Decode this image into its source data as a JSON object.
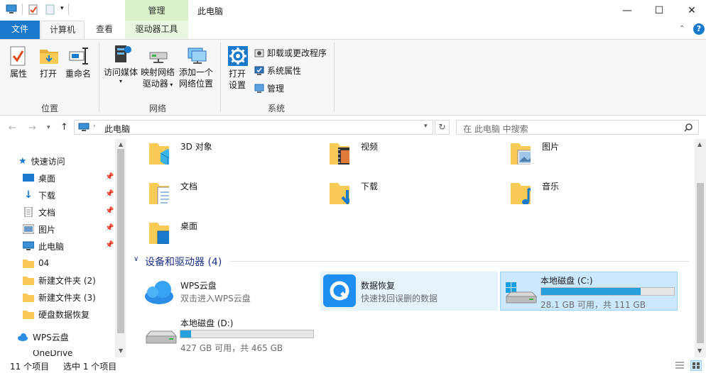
{
  "window": {
    "title": "此电脑",
    "context_tab": "管理"
  },
  "tabs": {
    "file": "文件",
    "computer": "计算机",
    "view": "查看",
    "drive_tools": "驱动器工具"
  },
  "ribbon": {
    "location": {
      "properties": "属性",
      "open": "打开",
      "rename": "重命名",
      "group": "位置"
    },
    "network": {
      "access_media": "访问媒体",
      "map_drive_1": "映射网络",
      "map_drive_2": "驱动器",
      "add_location_1": "添加一个",
      "add_location_2": "网络位置",
      "group": "网络"
    },
    "system": {
      "open_settings_1": "打开",
      "open_settings_2": "设置",
      "uninstall": "卸载或更改程序",
      "system_properties": "系统属性",
      "manage": "管理",
      "group": "系统"
    }
  },
  "address": {
    "path": "此电脑",
    "search_placeholder": "在 此电脑 中搜索"
  },
  "nav": {
    "quick_access": "快速访问",
    "items": [
      {
        "label": "桌面",
        "pinned": true
      },
      {
        "label": "下载",
        "pinned": true
      },
      {
        "label": "文档",
        "pinned": true
      },
      {
        "label": "图片",
        "pinned": true
      },
      {
        "label": "此电脑",
        "pinned": true
      },
      {
        "label": "04",
        "pinned": false
      },
      {
        "label": "新建文件夹 (2)",
        "pinned": false
      },
      {
        "label": "新建文件夹 (3)",
        "pinned": false
      },
      {
        "label": "硬盘数据恢复",
        "pinned": false
      }
    ],
    "wps": "WPS云盘",
    "onedrive_partial": "OneDrive"
  },
  "folders": [
    {
      "label": "3D 对象"
    },
    {
      "label": "视频"
    },
    {
      "label": "图片"
    },
    {
      "label": "文档"
    },
    {
      "label": "下载"
    },
    {
      "label": "音乐"
    },
    {
      "label": "桌面"
    }
  ],
  "devices": {
    "header": "设备和驱动器 (4)",
    "wps": {
      "name": "WPS云盘",
      "desc": "双击进入WPS云盘"
    },
    "recovery": {
      "name": "数据恢复",
      "desc": "快速找回误删的数据"
    },
    "drive_c": {
      "name": "本地磁盘 (C:)",
      "info": "28.1 GB 可用，共 111 GB",
      "used_fraction": 0.75
    },
    "drive_d": {
      "name": "本地磁盘 (D:)",
      "info": "427 GB 可用，共 465 GB",
      "used_fraction": 0.08
    }
  },
  "status": {
    "count": "11 个项目",
    "selected": "选中 1 个项目"
  },
  "colors": {
    "accent": "#1979ca",
    "context_green": "#d9f2c9",
    "selection": "#cce8ff",
    "hover": "#e5f3fb",
    "bar_fill": "#26a0da"
  }
}
